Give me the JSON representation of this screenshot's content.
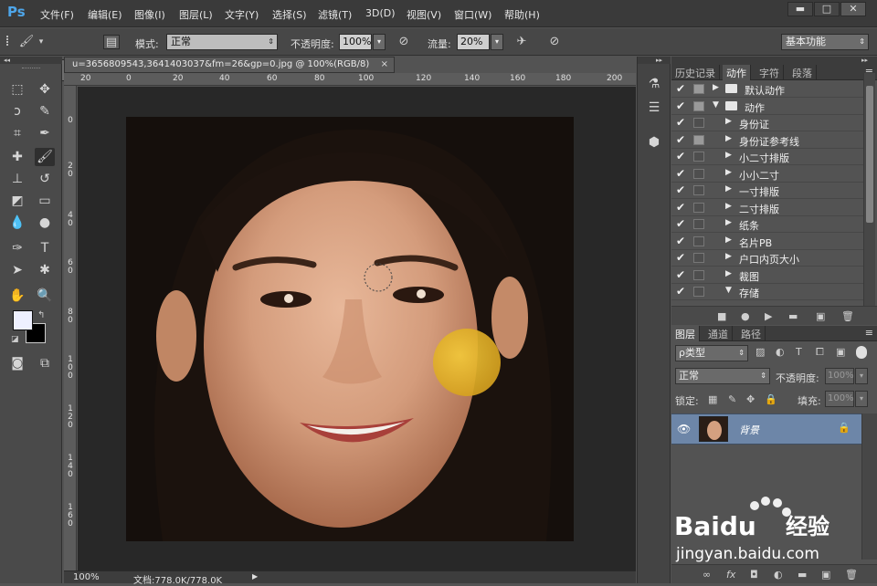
{
  "app": {
    "logo": "Ps"
  },
  "menu": [
    "文件(F)",
    "编辑(E)",
    "图像(I)",
    "图层(L)",
    "文字(Y)",
    "选择(S)",
    "滤镜(T)",
    "3D(D)",
    "视图(V)",
    "窗口(W)",
    "帮助(H)"
  ],
  "window_controls": {
    "minimize": "▬",
    "maximize": "□",
    "close": "✕"
  },
  "options": {
    "brush_size": "300",
    "mode_label": "模式:",
    "mode_value": "正常",
    "opacity_label": "不透明度:",
    "opacity_value": "100%",
    "flow_label": "流量:",
    "flow_value": "20%",
    "workspace": "基本功能"
  },
  "document": {
    "tab_title": "u=3656809543,3641403037&fm=26&gp=0.jpg @ 100%(RGB/8)",
    "close": "×",
    "ruler_top": [
      "20",
      "0",
      "20",
      "40",
      "60",
      "80",
      "100",
      "120",
      "140",
      "160",
      "180",
      "200"
    ],
    "ruler_left": [
      "0",
      "2\n0",
      "4\n0",
      "6\n0",
      "8\n0",
      "1\n0\n0",
      "1\n2\n0",
      "1\n4\n0",
      "1\n6\n0"
    ],
    "zoom": "100%",
    "doc_size": "文档:778.0K/778.0K",
    "status_arrow": "▶"
  },
  "colors": {
    "brush_spot": "#e8b92a",
    "layer_selected": "#6d86a8",
    "accent": "#4ea6ea"
  },
  "panel_top": {
    "tabs": [
      "历史记录",
      "动作",
      "字符",
      "段落"
    ],
    "active_tab": "动作",
    "menu_icon": "≡",
    "actions": [
      {
        "label": "默认动作",
        "type": "set",
        "expanded": false,
        "toggle": true
      },
      {
        "label": "动作",
        "type": "set",
        "expanded": true,
        "toggle": true
      },
      {
        "label": "身份证",
        "type": "action",
        "toggle": false
      },
      {
        "label": "身份证参考线",
        "type": "action",
        "toggle": true
      },
      {
        "label": "小二寸排版",
        "type": "action",
        "toggle": false
      },
      {
        "label": "小小二寸",
        "type": "action",
        "toggle": false
      },
      {
        "label": "一寸排版",
        "type": "action",
        "toggle": false
      },
      {
        "label": "二寸排版",
        "type": "action",
        "toggle": false
      },
      {
        "label": "纸条",
        "type": "action",
        "toggle": false
      },
      {
        "label": "名片PB",
        "type": "action",
        "toggle": false
      },
      {
        "label": "户口内页大小",
        "type": "action",
        "toggle": false
      },
      {
        "label": "裁图",
        "type": "action",
        "toggle": false
      },
      {
        "label": "存储",
        "type": "action",
        "toggle": false,
        "expanded": true
      }
    ],
    "bottom_tools": [
      "■",
      "●",
      "▶",
      "▬",
      "▣",
      "🗑"
    ]
  },
  "layers_panel": {
    "tabs": [
      "图层",
      "通道",
      "路径"
    ],
    "active_tab": "图层",
    "filter_label": "ρ类型",
    "blend_mode": "正常",
    "opacity_label": "不透明度:",
    "opacity_value": "100%",
    "lock_label": "锁定:",
    "fill_label": "填充:",
    "fill_value": "100%",
    "layer_name": "背景",
    "bottom_tools": [
      "∞",
      "fx",
      "◘",
      "◐",
      "▬",
      "▣",
      "🗑"
    ]
  },
  "watermark": {
    "brand": "Baidu",
    "sub": "经验",
    "url": "jingyan.baidu.com"
  }
}
